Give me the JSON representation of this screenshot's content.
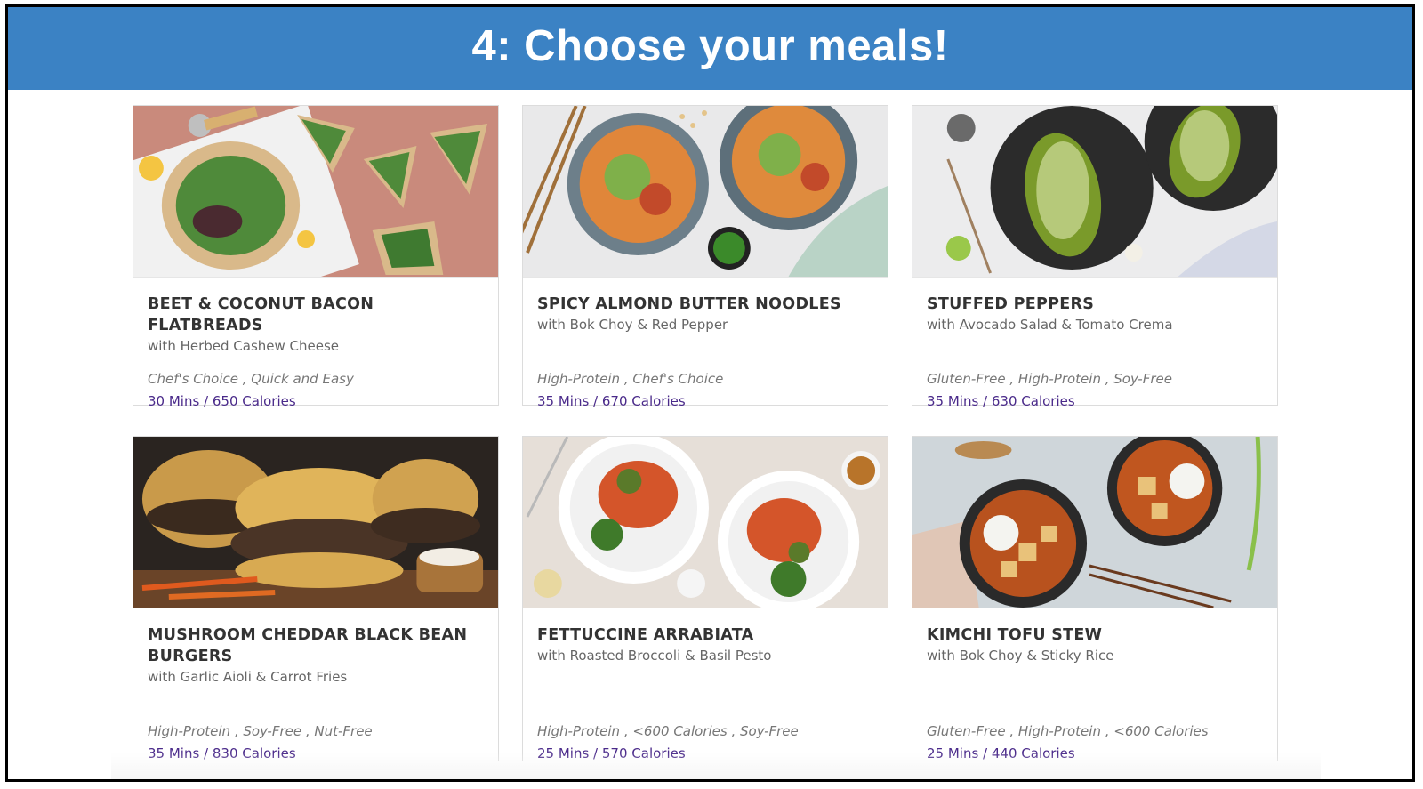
{
  "banner": {
    "title": "4: Choose your meals!"
  },
  "meals": [
    {
      "title": "BEET & COCONUT BACON FLATBREADS",
      "subtitle": "with Herbed Cashew Cheese",
      "tags": "Chef's Choice , Quick and Easy",
      "meta": "30 Mins / 650 Calories"
    },
    {
      "title": "SPICY ALMOND BUTTER NOODLES",
      "subtitle": "with Bok Choy & Red Pepper",
      "tags": "High-Protein , Chef's Choice",
      "meta": "35 Mins / 670 Calories"
    },
    {
      "title": "STUFFED PEPPERS",
      "subtitle": "with Avocado Salad & Tomato Crema",
      "tags": "Gluten-Free , High-Protein , Soy-Free",
      "meta": "35 Mins / 630 Calories"
    },
    {
      "title": "MUSHROOM CHEDDAR BLACK BEAN BURGERS",
      "subtitle": "with Garlic Aioli & Carrot Fries",
      "tags": "High-Protein , Soy-Free , Nut-Free",
      "meta": "35 Mins / 830 Calories"
    },
    {
      "title": "FETTUCCINE ARRABIATA",
      "subtitle": "with Roasted Broccoli & Basil Pesto",
      "tags": "High-Protein , <600 Calories , Soy-Free",
      "meta": "25 Mins / 570 Calories"
    },
    {
      "title": "KIMCHI TOFU STEW",
      "subtitle": "with Bok Choy & Sticky Rice",
      "tags": "Gluten-Free , High-Protein , <600 Calories",
      "meta": "25 Mins / 440 Calories"
    }
  ]
}
